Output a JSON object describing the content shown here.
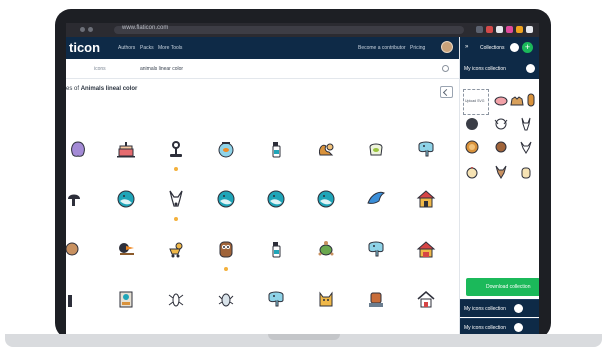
{
  "browser": {
    "url": "www.flaticon.com"
  },
  "nav": {
    "logo": "ticon",
    "links": [
      "Authors",
      "Packs",
      "More Tools"
    ],
    "cta": "Become a contributor",
    "pricing": "Pricing"
  },
  "search": {
    "type": "icons",
    "query": "animals linear color"
  },
  "heading": {
    "prefix": "es of",
    "term": "Animals lineal color"
  },
  "side_panel": {
    "title": "Collections",
    "collection_name": "My icons collection",
    "upload_label": "Upload SVG",
    "download_label": "Download collection",
    "collections": [
      "My icons collection",
      "My icons collection"
    ]
  },
  "colors": {
    "navy": "#0e2a47",
    "accent_green": "#1bb95a",
    "teal": "#1fa5b8",
    "star": "#f3b13d"
  },
  "icons": [
    [
      "purple-creature-icon",
      "birthday-cake-icon",
      "pet-toy-icon",
      "fishbowl-icon",
      "pet-spray-icon",
      "squirrel-icon",
      "fish-bag-icon",
      "elephant-icon"
    ],
    [
      "mushroom-icon",
      "blue-bird-icon",
      "donkey-icon",
      "blue-bird-icon",
      "blue-bird-icon",
      "blue-bird-icon",
      "dolphin-icon",
      "dog-house-icon"
    ],
    [
      "snail-icon",
      "toucan-icon",
      "duck-pull-toy-icon",
      "owl-icon",
      "pet-spray-icon",
      "turtle-icon",
      "elephant-icon",
      "dog-house-icon"
    ],
    [
      "mole-icon",
      "pet-book-icon",
      "insect-icon",
      "beetle-icon",
      "elephant-icon",
      "cat-icon",
      "dog-toy-icon",
      "pet-house-icon"
    ]
  ],
  "collection_icons": [
    "pig-icon",
    "camel-icon",
    "alpaca-icon",
    "gorilla-icon",
    "dog-icon",
    "donkey-icon",
    "lion-icon",
    "cow-icon",
    "goat-icon",
    "hen-icon",
    "deer-icon",
    "bull-icon"
  ]
}
